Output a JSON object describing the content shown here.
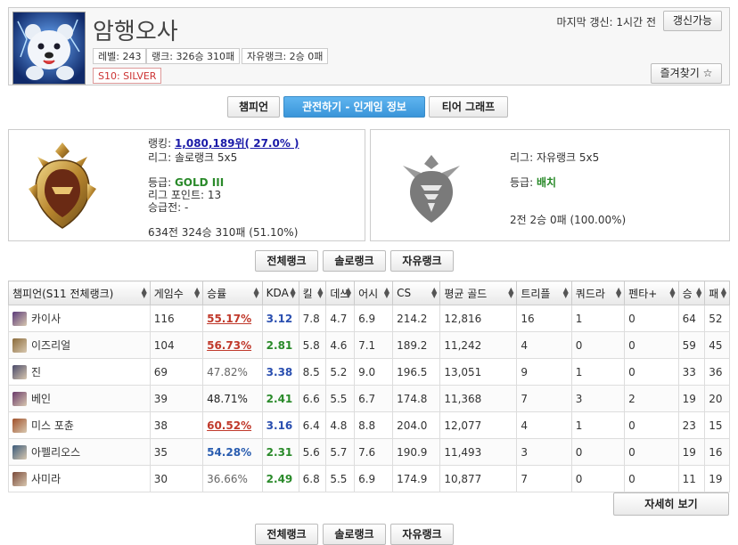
{
  "header": {
    "summoner_name": "암행오사",
    "level": "레벨: 243",
    "rank_record": "랭크: 326승 310패",
    "flex_record": "자유랭크: 2승 0패",
    "previous_tier": "S10: SILVER",
    "last_update": "마지막 갱신: 1시간 전",
    "refresh_label": "갱신가능",
    "favorite_label": "즐겨찾기 ☆"
  },
  "tabs": [
    {
      "label": "챔피언"
    },
    {
      "label": "관전하기 - 인게임 정보",
      "active": true
    },
    {
      "label": "티어 그래프"
    }
  ],
  "solo_rank": {
    "ranking_label": "랭킹: ",
    "ranking_value": "1,080,189위( 27.0% )",
    "league": "리그: 솔로랭크 5x5",
    "tier_label": "등급: ",
    "tier_value": "GOLD III",
    "league_points": "리그 포인트: 13",
    "promo": "승급전: -",
    "record": "634전 324승 310패 (51.10%)"
  },
  "flex_rank": {
    "league": "리그: 자유랭크 5x5",
    "tier_label": "등급: ",
    "tier_value": "배치",
    "record": "2전 2승 0패 (100.00%)"
  },
  "queue_buttons": [
    "전체랭크",
    "솔로랭크",
    "자유랭크"
  ],
  "table": {
    "headers": [
      "챔피언(S11 전체랭크)",
      "게임수",
      "승률",
      "KDA",
      "킬",
      "데쓰",
      "어시",
      "CS",
      "평균 골드",
      "트리플",
      "쿼드라",
      "펜타+",
      "승",
      "패"
    ],
    "rows": [
      {
        "champion": "카이사",
        "games": "116",
        "winrate": "55.17%",
        "wr_class": "wr-high",
        "kda": "3.12",
        "kda_class": "kda-blue",
        "k": "7.8",
        "d": "4.7",
        "a": "6.9",
        "cs": "214.2",
        "gold": "12,816",
        "triple": "16",
        "quadra": "1",
        "penta": "0",
        "w": "64",
        "l": "52",
        "icon": "#5b3a7a"
      },
      {
        "champion": "이즈리얼",
        "games": "104",
        "winrate": "56.73%",
        "wr_class": "wr-high",
        "kda": "2.81",
        "kda_class": "kda-green",
        "k": "5.8",
        "d": "4.6",
        "a": "7.1",
        "cs": "189.2",
        "gold": "11,242",
        "triple": "4",
        "quadra": "0",
        "penta": "0",
        "w": "59",
        "l": "45",
        "icon": "#8a6a3a"
      },
      {
        "champion": "진",
        "games": "69",
        "winrate": "47.82%",
        "wr_class": "wr-low",
        "kda": "3.38",
        "kda_class": "kda-blue",
        "k": "8.5",
        "d": "5.2",
        "a": "9.0",
        "cs": "196.5",
        "gold": "13,051",
        "triple": "9",
        "quadra": "1",
        "penta": "0",
        "w": "33",
        "l": "36",
        "icon": "#4a4a6a"
      },
      {
        "champion": "베인",
        "games": "39",
        "winrate": "48.71%",
        "wr_class": "wr-norm",
        "kda": "2.41",
        "kda_class": "kda-green",
        "k": "6.6",
        "d": "5.5",
        "a": "6.7",
        "cs": "174.8",
        "gold": "11,368",
        "triple": "7",
        "quadra": "3",
        "penta": "2",
        "w": "19",
        "l": "20",
        "icon": "#6a3a6a"
      },
      {
        "champion": "미스 포츈",
        "games": "38",
        "winrate": "60.52%",
        "wr_class": "wr-high",
        "kda": "3.16",
        "kda_class": "kda-blue",
        "k": "6.4",
        "d": "4.8",
        "a": "8.8",
        "cs": "204.0",
        "gold": "12,077",
        "triple": "4",
        "quadra": "1",
        "penta": "0",
        "w": "23",
        "l": "15",
        "icon": "#a0502a"
      },
      {
        "champion": "아펠리오스",
        "games": "35",
        "winrate": "54.28%",
        "wr_class": "wr-good",
        "kda": "2.31",
        "kda_class": "kda-green",
        "k": "5.6",
        "d": "5.7",
        "a": "7.6",
        "cs": "190.9",
        "gold": "11,493",
        "triple": "3",
        "quadra": "0",
        "penta": "0",
        "w": "19",
        "l": "16",
        "icon": "#3a5a7a"
      },
      {
        "champion": "사미라",
        "games": "30",
        "winrate": "36.66%",
        "wr_class": "wr-low",
        "kda": "2.49",
        "kda_class": "kda-green",
        "k": "6.8",
        "d": "5.5",
        "a": "6.9",
        "cs": "174.9",
        "gold": "10,877",
        "triple": "7",
        "quadra": "0",
        "penta": "0",
        "w": "11",
        "l": "19",
        "icon": "#7a4a3a"
      }
    ]
  },
  "detail_label": "자세히 보기"
}
